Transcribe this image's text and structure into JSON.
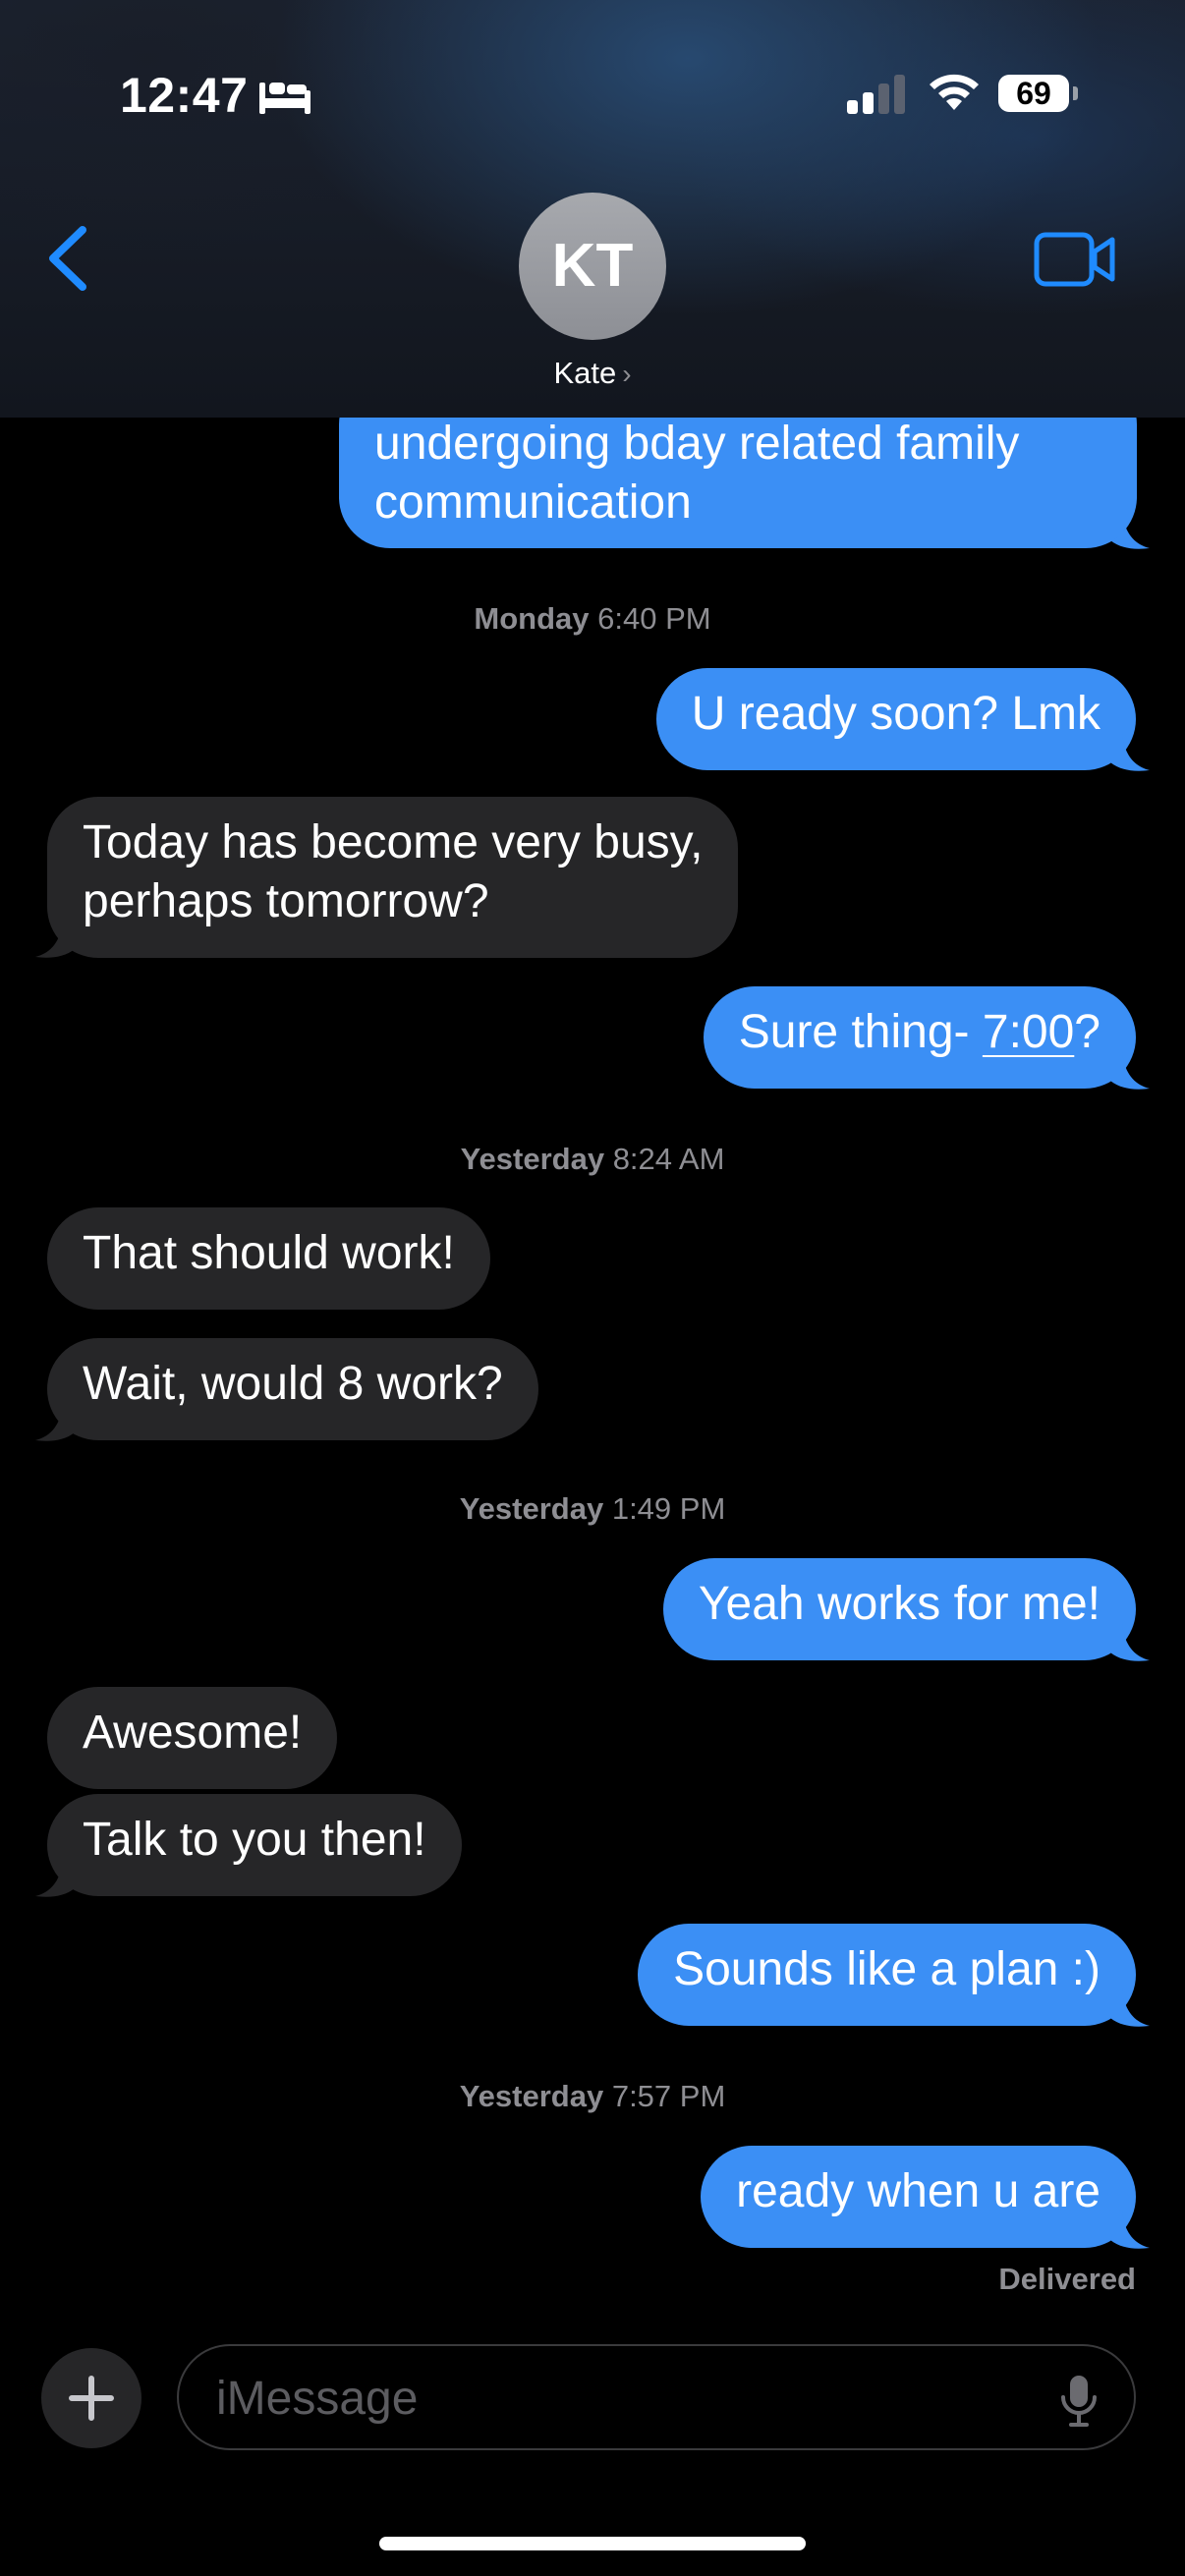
{
  "status_bar": {
    "time": "12:47",
    "battery": "69"
  },
  "header": {
    "avatar_initials": "KT",
    "contact_name": "Kate",
    "contact_chevron": "›"
  },
  "messages": {
    "m0_line1": "undergoing bday related family",
    "m0_line2": "communication",
    "ts1": {
      "day": "Monday",
      "time": "6:40 PM"
    },
    "m1": "U ready soon? Lmk",
    "m2_line1": "Today has become very busy,",
    "m2_line2": "perhaps tomorrow?",
    "m3_prefix": "Sure thing- ",
    "m3_link": "7:00",
    "m3_suffix": "?",
    "ts2": {
      "day": "Yesterday",
      "time": "8:24 AM"
    },
    "m4": "That should work!",
    "m5": "Wait, would 8 work?",
    "ts3": {
      "day": "Yesterday",
      "time": "1:49 PM"
    },
    "m6": "Yeah works for me!",
    "m7": "Awesome!",
    "m8": "Talk to you then!",
    "m9": "Sounds like a plan :)",
    "ts4": {
      "day": "Yesterday",
      "time": "7:57 PM"
    },
    "m10": "ready when u are",
    "delivered": "Delivered"
  },
  "composer": {
    "placeholder": "iMessage"
  },
  "colors": {
    "sent_bubble": "#3b8ff5",
    "received_bubble": "#262628",
    "accent": "#1f8bff",
    "background": "#000000"
  },
  "icons": [
    "bed-icon",
    "cellular-signal-icon",
    "wifi-icon",
    "battery-icon",
    "back-chevron-icon",
    "video-call-icon",
    "plus-icon",
    "microphone-icon"
  ]
}
